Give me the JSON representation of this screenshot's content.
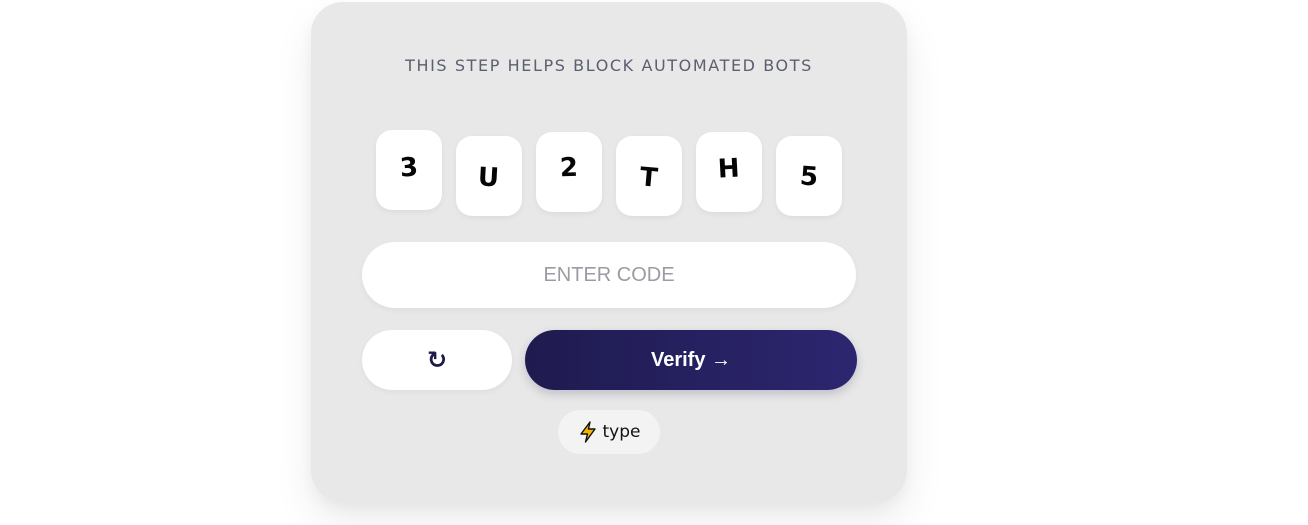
{
  "captcha": {
    "subtitle": "THIS STEP HELPS BLOCK AUTOMATED BOTS",
    "characters": [
      "3",
      "U",
      "2",
      "T",
      "H",
      "5"
    ],
    "input": {
      "placeholder": "ENTER CODE",
      "value": ""
    },
    "refresh_icon": "↻",
    "refresh_icon_name": "refresh-icon",
    "verify_label": "Verify →",
    "mode_icon": "lightning-bolt-icon",
    "mode_label": "type",
    "colors": {
      "card_background": "#e9e8e8",
      "verify_gradient_start": "#1f1b4f",
      "verify_gradient_end": "#2c2670",
      "bolt_fill": "#f5b400"
    }
  }
}
